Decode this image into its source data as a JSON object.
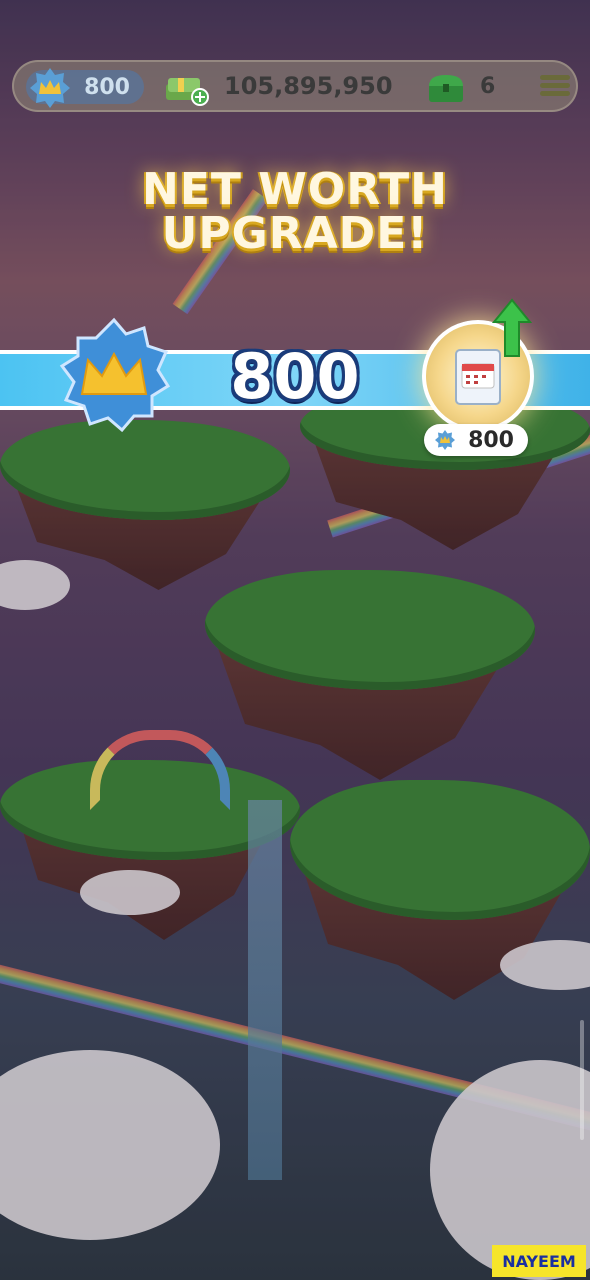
{
  "top_bar": {
    "net_worth": "800",
    "cash": "105,895,950",
    "chests": "6",
    "icons": {
      "net_worth": "net-worth-badge-icon",
      "cash": "cash-stack-plus-icon",
      "chest": "green-chest-icon",
      "menu": "hamburger-menu-icon"
    }
  },
  "title": {
    "line1": "NET WORTH",
    "line2": "UPGRADE!"
  },
  "banner": {
    "value": "800",
    "reward_value": "800",
    "icons": {
      "badge": "m-star-badge-icon",
      "reward": "calendar-card-icon",
      "arrow": "green-up-arrow-icon"
    }
  },
  "watermark": "NAYEEM",
  "colors": {
    "banner": "#4cc3f2",
    "title_gold": "#d8a820",
    "watermark_bg": "#f6e52a",
    "watermark_text": "#1a2fa0"
  }
}
